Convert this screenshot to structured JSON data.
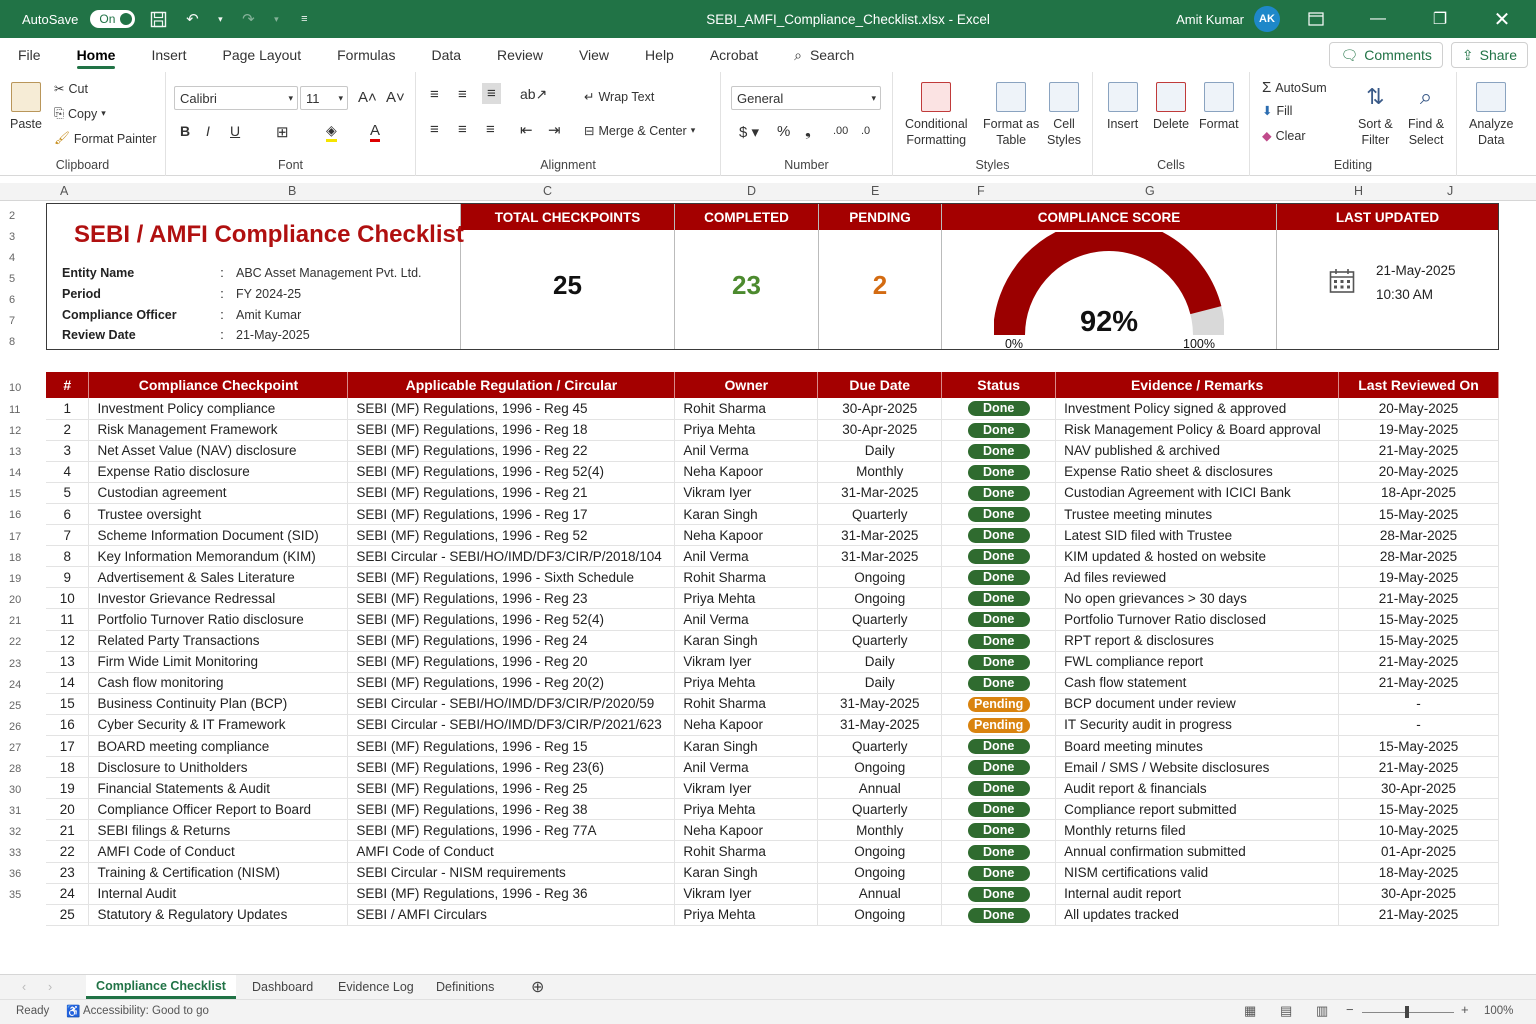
{
  "titlebar": {
    "autosave_label": "AutoSave",
    "autosave_state": "On",
    "file_title": "SEBI_AMFI_Compliance_Checklist.xlsx - Excel",
    "user_name": "Amit Kumar",
    "user_initials": "AK"
  },
  "menu": {
    "items": [
      "File",
      "Home",
      "Insert",
      "Page Layout",
      "Formulas",
      "Data",
      "Review",
      "View",
      "Help",
      "Acrobat"
    ],
    "search": "Search",
    "comments": "Comments",
    "share": "Share"
  },
  "ribbon": {
    "paste": "Paste",
    "cut": "Cut",
    "copy": "Copy",
    "format_painter": "Format Painter",
    "clipboard": "Clipboard",
    "font_name": "Calibri",
    "font_size": "11",
    "font": "Font",
    "alignment": "Alignment",
    "wrap_text": "Wrap Text",
    "merge_center": "Merge & Center",
    "number_format": "General",
    "number": "Number",
    "conditional_formatting_1": "Conditional",
    "conditional_formatting_2": "Formatting",
    "format_as_table_1": "Format as",
    "format_as_table_2": "Table",
    "cell_styles_1": "Cell",
    "cell_styles_2": "Styles",
    "styles": "Styles",
    "insert": "Insert",
    "delete": "Delete",
    "format": "Format",
    "cells": "Cells",
    "autosum": "AutoSum",
    "fill": "Fill",
    "clear": "Clear",
    "sort_filter_1": "Sort &",
    "sort_filter_2": "Filter",
    "find_select_1": "Find &",
    "find_select_2": "Select",
    "editing": "Editing",
    "analyze_1": "Analyze",
    "analyze_2": "Data"
  },
  "columns": [
    "A",
    "B",
    "C",
    "D",
    "E",
    "F",
    "G",
    "H",
    "J"
  ],
  "rows": [
    "2",
    "3",
    "4",
    "5",
    "6",
    "7",
    "8",
    "10",
    "11",
    "12",
    "13",
    "14",
    "15",
    "16",
    "17",
    "18",
    "19",
    "20",
    "21",
    "22",
    "23",
    "24",
    "25",
    "26",
    "27",
    "28",
    "30",
    "31",
    "32",
    "33",
    "36",
    "35"
  ],
  "header_card": {
    "title": "SEBI / AMFI Compliance Checklist",
    "entity_label": "Entity Name",
    "entity_value": "ABC Asset Management Pvt. Ltd.",
    "period_label": "Period",
    "period_value": "FY 2024-25",
    "officer_label": "Compliance Officer",
    "officer_value": "Amit Kumar",
    "review_label": "Review Date",
    "review_value": "21-May-2025",
    "colon": ":"
  },
  "kpis": {
    "total_label": "TOTAL CHECKPOINTS",
    "total_value": "25",
    "completed_label": "COMPLETED",
    "completed_value": "23",
    "pending_label": "PENDING",
    "pending_value": "2",
    "score_label": "COMPLIANCE SCORE",
    "score_value": "92%",
    "score_fraction": 0.92,
    "gauge_min": "0%",
    "gauge_max": "100%",
    "updated_label": "LAST UPDATED",
    "updated_date": "21-May-2025",
    "updated_time": "10:30 AM"
  },
  "colors": {
    "excel_green": "#217346",
    "header_red": "#a40000",
    "done_green": "#2f6b2f",
    "pending_orange": "#d9830f",
    "completed_green": "#4c8a2e",
    "pending_text": "#d36b12"
  },
  "table": {
    "headers": [
      "#",
      "Compliance Checkpoint",
      "Applicable Regulation / Circular",
      "Owner",
      "Due Date",
      "Status",
      "Evidence / Remarks",
      "Last Reviewed On"
    ],
    "rows": [
      [
        "1",
        "Investment Policy compliance",
        "SEBI (MF) Regulations, 1996 - Reg 45",
        "Rohit Sharma",
        "30-Apr-2025",
        "Done",
        "Investment Policy signed & approved",
        "20-May-2025"
      ],
      [
        "2",
        "Risk Management Framework",
        "SEBI (MF) Regulations, 1996 - Reg 18",
        "Priya Mehta",
        "30-Apr-2025",
        "Done",
        "Risk Management Policy & Board approval",
        "19-May-2025"
      ],
      [
        "3",
        "Net Asset Value (NAV) disclosure",
        "SEBI (MF) Regulations, 1996 - Reg 22",
        "Anil Verma",
        "Daily",
        "Done",
        "NAV published & archived",
        "21-May-2025"
      ],
      [
        "4",
        "Expense Ratio disclosure",
        "SEBI (MF) Regulations, 1996 - Reg 52(4)",
        "Neha Kapoor",
        "Monthly",
        "Done",
        "Expense Ratio sheet & disclosures",
        "20-May-2025"
      ],
      [
        "5",
        "Custodian agreement",
        "SEBI (MF) Regulations, 1996 - Reg 21",
        "Vikram Iyer",
        "31-Mar-2025",
        "Done",
        "Custodian Agreement with ICICI Bank",
        "18-Apr-2025"
      ],
      [
        "6",
        "Trustee oversight",
        "SEBI (MF) Regulations, 1996 - Reg 17",
        "Karan Singh",
        "Quarterly",
        "Done",
        "Trustee meeting minutes",
        "15-May-2025"
      ],
      [
        "7",
        "Scheme Information Document (SID)",
        "SEBI (MF) Regulations, 1996 - Reg 52",
        "Neha Kapoor",
        "31-Mar-2025",
        "Done",
        "Latest SID filed with Trustee",
        "28-Mar-2025"
      ],
      [
        "8",
        "Key Information Memorandum (KIM)",
        "SEBI Circular - SEBI/HO/IMD/DF3/CIR/P/2018/104",
        "Anil Verma",
        "31-Mar-2025",
        "Done",
        "KIM updated & hosted on website",
        "28-Mar-2025"
      ],
      [
        "9",
        "Advertisement & Sales Literature",
        "SEBI (MF) Regulations, 1996 - Sixth Schedule",
        "Rohit Sharma",
        "Ongoing",
        "Done",
        "Ad files reviewed",
        "19-May-2025"
      ],
      [
        "10",
        "Investor Grievance Redressal",
        "SEBI (MF) Regulations, 1996 - Reg 23",
        "Priya Mehta",
        "Ongoing",
        "Done",
        "No open grievances > 30 days",
        "21-May-2025"
      ],
      [
        "11",
        "Portfolio Turnover Ratio disclosure",
        "SEBI (MF) Regulations, 1996 - Reg 52(4)",
        "Anil Verma",
        "Quarterly",
        "Done",
        "Portfolio Turnover Ratio disclosed",
        "15-May-2025"
      ],
      [
        "12",
        "Related Party Transactions",
        "SEBI (MF) Regulations, 1996 - Reg 24",
        "Karan Singh",
        "Quarterly",
        "Done",
        "RPT report & disclosures",
        "15-May-2025"
      ],
      [
        "13",
        "Firm Wide Limit Monitoring",
        "SEBI (MF) Regulations, 1996 - Reg 20",
        "Vikram Iyer",
        "Daily",
        "Done",
        "FWL compliance report",
        "21-May-2025"
      ],
      [
        "14",
        "Cash flow monitoring",
        "SEBI (MF) Regulations, 1996 - Reg 20(2)",
        "Priya Mehta",
        "Daily",
        "Done",
        "Cash flow statement",
        "21-May-2025"
      ],
      [
        "15",
        "Business Continuity Plan (BCP)",
        "SEBI Circular - SEBI/HO/IMD/DF3/CIR/P/2020/59",
        "Rohit Sharma",
        "31-May-2025",
        "Pending",
        "BCP document under review",
        "-"
      ],
      [
        "16",
        "Cyber Security & IT Framework",
        "SEBI Circular - SEBI/HO/IMD/DF3/CIR/P/2021/623",
        "Neha Kapoor",
        "31-May-2025",
        "Pending",
        "IT Security audit in progress",
        "-"
      ],
      [
        "17",
        "BOARD meeting compliance",
        "SEBI (MF) Regulations, 1996 - Reg 15",
        "Karan Singh",
        "Quarterly",
        "Done",
        "Board meeting minutes",
        "15-May-2025"
      ],
      [
        "18",
        "Disclosure to Unitholders",
        "SEBI (MF) Regulations, 1996 - Reg 23(6)",
        "Anil Verma",
        "Ongoing",
        "Done",
        "Email / SMS / Website disclosures",
        "21-May-2025"
      ],
      [
        "19",
        "Financial Statements & Audit",
        "SEBI (MF) Regulations, 1996 - Reg 25",
        "Vikram Iyer",
        "Annual",
        "Done",
        "Audit report & financials",
        "30-Apr-2025"
      ],
      [
        "20",
        "Compliance Officer Report to Board",
        "SEBI (MF) Regulations, 1996 - Reg 38",
        "Priya Mehta",
        "Quarterly",
        "Done",
        "Compliance report submitted",
        "15-May-2025"
      ],
      [
        "21",
        "SEBI filings & Returns",
        "SEBI (MF) Regulations, 1996 - Reg 77A",
        "Neha Kapoor",
        "Monthly",
        "Done",
        "Monthly returns filed",
        "10-May-2025"
      ],
      [
        "22",
        "AMFI Code of Conduct",
        "AMFI Code of Conduct",
        "Rohit Sharma",
        "Ongoing",
        "Done",
        "Annual confirmation submitted",
        "01-Apr-2025"
      ],
      [
        "23",
        "Training & Certification (NISM)",
        "SEBI Circular - NISM requirements",
        "Karan Singh",
        "Ongoing",
        "Done",
        "NISM certifications valid",
        "18-May-2025"
      ],
      [
        "24",
        "Internal Audit",
        "SEBI (MF) Regulations, 1996 - Reg 36",
        "Vikram Iyer",
        "Annual",
        "Done",
        "Internal audit report",
        "30-Apr-2025"
      ],
      [
        "25",
        "Statutory & Regulatory Updates",
        "SEBI / AMFI Circulars",
        "Priya Mehta",
        "Ongoing",
        "Done",
        "All updates tracked",
        "21-May-2025"
      ]
    ]
  },
  "sheet_tabs": [
    "Compliance Checklist",
    "Dashboard",
    "Evidence Log",
    "Definitions"
  ],
  "status_bar": {
    "ready": "Ready",
    "accessibility": "Accessibility: Good to go",
    "zoom": "100%"
  }
}
